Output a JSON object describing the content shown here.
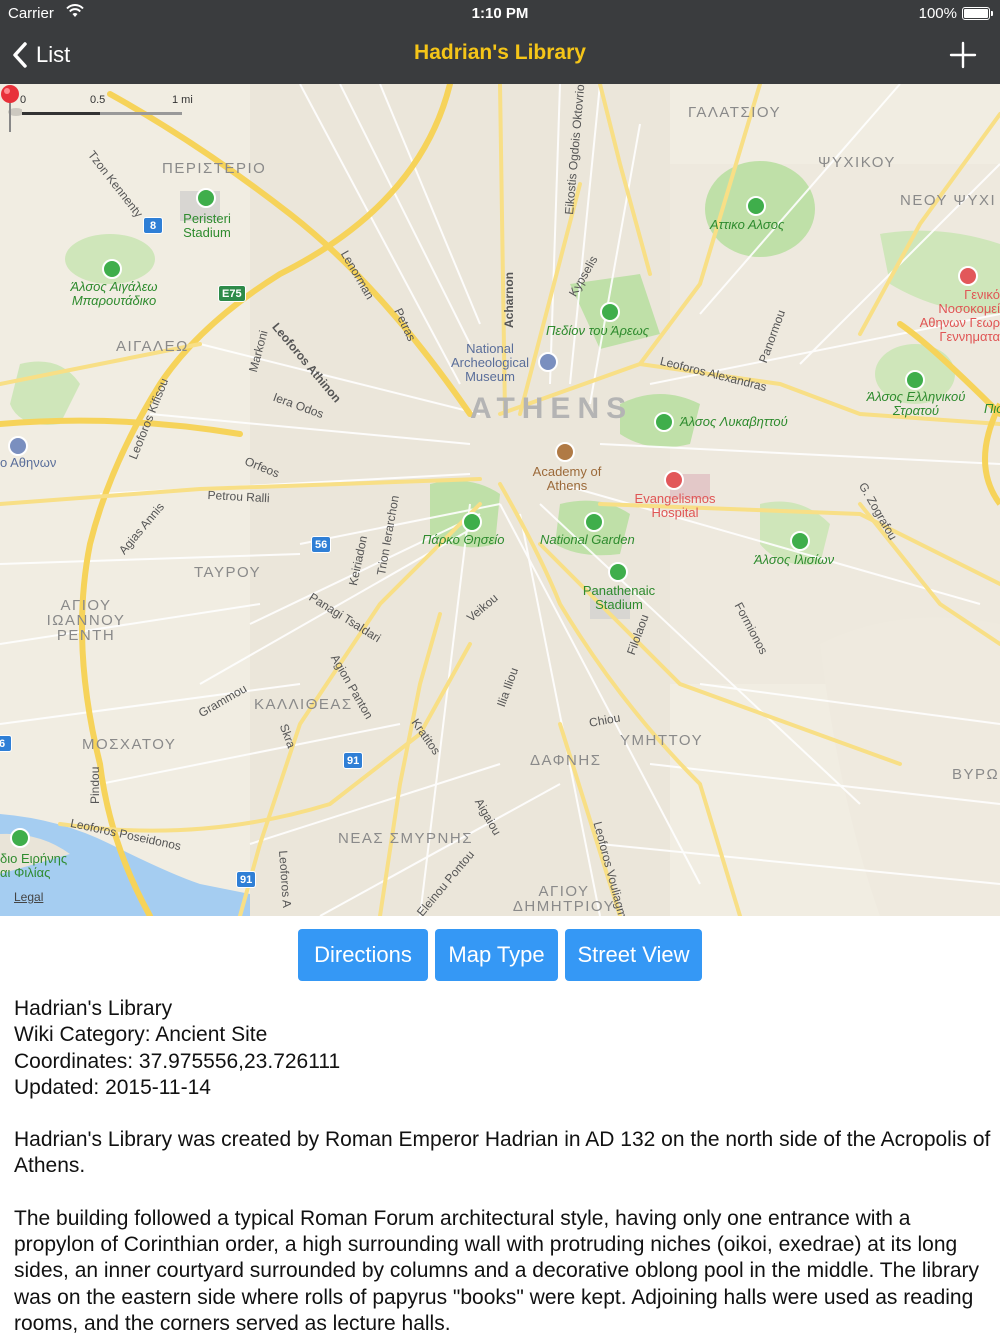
{
  "status_bar": {
    "carrier": "Carrier",
    "time": "1:10 PM",
    "battery": "100%"
  },
  "nav": {
    "back_label": "List",
    "title": "Hadrian's Library",
    "title_color": "#f5c518",
    "add_icon": "plus-icon"
  },
  "map": {
    "scale": {
      "zero": "0",
      "half": "0.5",
      "one": "1 mi"
    },
    "city_label": "ATHENS",
    "districts": [
      "ΠΕΡΙΣΤΕΡΙΟ",
      "ΑΙΓΑΛΕΩ",
      "ΤΑΥΡΟΥ",
      "ΑΓΙΟΥ ΙΩΑΝΝΟΥ ΡΕΝΤΗ",
      "ΚΑΛΛΙΘΕΑΣ",
      "ΜΟΣΧΑΤΟΥ",
      "ΝΕΑΣ ΣΜΥΡΝΗΣ",
      "ΑΓΙΟΥ ΔΗΜΗΤΡΙΟΥ",
      "ΔΑΦΝΗΣ",
      "ΥΜΗΤΤΟΥ",
      "ΓΑΛΑΤΣΙΟΥ",
      "ΨΥΧΙΚΟΥ",
      "ΝΕΟΥ ΨΥΧΙ",
      "ΒΥΡΩ"
    ],
    "parks": [
      "Αττικο Αλσος",
      "Πεδίον του Άρεως",
      "Άλσος Λυκαβηττού",
      "Άλσος Ελληνικού Στρατού",
      "Άλσος Αιγάλεω Μπαρουτάδικο",
      "Πάρκο Θησείο",
      "National Garden",
      "Άλσος Ιλισίων",
      "Πισω"
    ],
    "pois": {
      "peristeri_stadium": "Peristeri Stadium",
      "museum": "National Archeological Museum",
      "academy": "Academy of Athens",
      "hospital": "Evangelismos Hospital",
      "panathenaic": "Panathenaic Stadium",
      "general_hospital": "Γενικό Νοσοκομεί Αθηνων Γεωρ Γεννηματα",
      "piraeus": "διο Ειρήνης αι Φιλίας",
      "athens_west": "ο Αθηνων"
    },
    "roads": [
      "Tzon Kennenty",
      "Leoforos Athinon",
      "Lenorman",
      "Petras",
      "Acharnon",
      "Kypselis",
      "Eikostis Ogdois Oktovriou",
      "Leoforos Alexandras",
      "Panormou",
      "Iera Odos",
      "Orfeos",
      "Petrou Ralli",
      "Agias Annis",
      "Leoforos Kifisou",
      "Markoni",
      "Keiriadon",
      "Trion Ierarchon",
      "Panagi Tsaldari",
      "Veikou",
      "Filolaou",
      "Formionos",
      "G. Zografou",
      "Grammou",
      "Agion Panton",
      "Ilia Iliou",
      "Chiou",
      "Kratitos",
      "Skra",
      "Aigaiou",
      "Pindou",
      "Leoforos Poseidonos",
      "Leoforos Vouliagmenis",
      "Eleinou Pontou",
      "Leoforos A"
    ],
    "shields": [
      "8",
      "E75",
      "56",
      "91",
      "91",
      "6"
    ],
    "legal": "Legal"
  },
  "buttons": {
    "directions": "Directions",
    "map_type": "Map Type",
    "street_view": "Street View",
    "color": "#3598f5"
  },
  "info": {
    "name": "Hadrian's Library",
    "category": "Wiki Category: Ancient Site",
    "coordinates": "Coordinates: 37.975556,23.726111",
    "updated": "Updated: 2015-11-14",
    "para1": "Hadrian's Library was created by Roman Emperor Hadrian in AD 132 on the north side of the Acropolis of Athens.",
    "para2": "The building followed a typical Roman Forum architectural style, having only one entrance with a propylon of Corinthian order, a high surrounding wall with protruding niches (oikoi, exedrae) at its long sides, an inner courtyard surrounded by columns and a decorative oblong pool in the middle. The library was on the eastern side where rolls of papyrus \"books\" were kept. Adjoining halls were used as reading rooms, and the corners served as lecture halls."
  }
}
